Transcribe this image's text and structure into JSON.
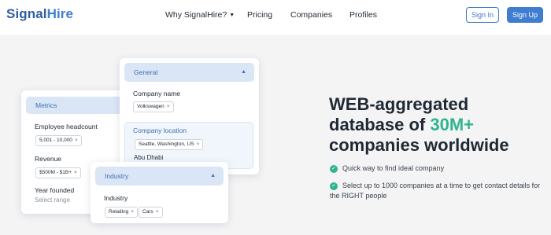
{
  "nav": {
    "logo_signal": "Signal",
    "logo_hire": "Hire",
    "links": [
      "Why SignalHire?",
      "Pricing",
      "Companies",
      "Profiles"
    ],
    "signin": "Sign In",
    "signup": "Sign Up"
  },
  "filters": {
    "general": {
      "title": "General",
      "company_name_label": "Company name",
      "company_name_chip": "Volkswagen",
      "location_label": "Company location",
      "location_chip": "Seattle, Washington, US",
      "location_input": "Abu Dhabi"
    },
    "metrics": {
      "title": "Metrics",
      "headcount_label": "Employee headcount",
      "headcount_chip": "5,001 - 10,000",
      "revenue_label": "Revenue",
      "revenue_chip": "$500M - $1B+",
      "year_label": "Year founded",
      "year_placeholder": "Select range"
    },
    "industry": {
      "title": "Industry",
      "industry_label": "Industry",
      "chips": [
        "Retailing",
        "Cars"
      ]
    }
  },
  "hero": {
    "line1": "WEB-aggregated",
    "line2_prefix": "database of ",
    "line2_accent": "30M+",
    "line3": "companies worldwide",
    "bullet1": "Quick way to find ideal company",
    "bullet2": "Select up to 1000 companies at a time to get contact details for the RIGHT people"
  },
  "colors": {
    "brand": "#3f7dd1",
    "accent": "#2fb48f",
    "header_bg": "#dae6f5"
  }
}
